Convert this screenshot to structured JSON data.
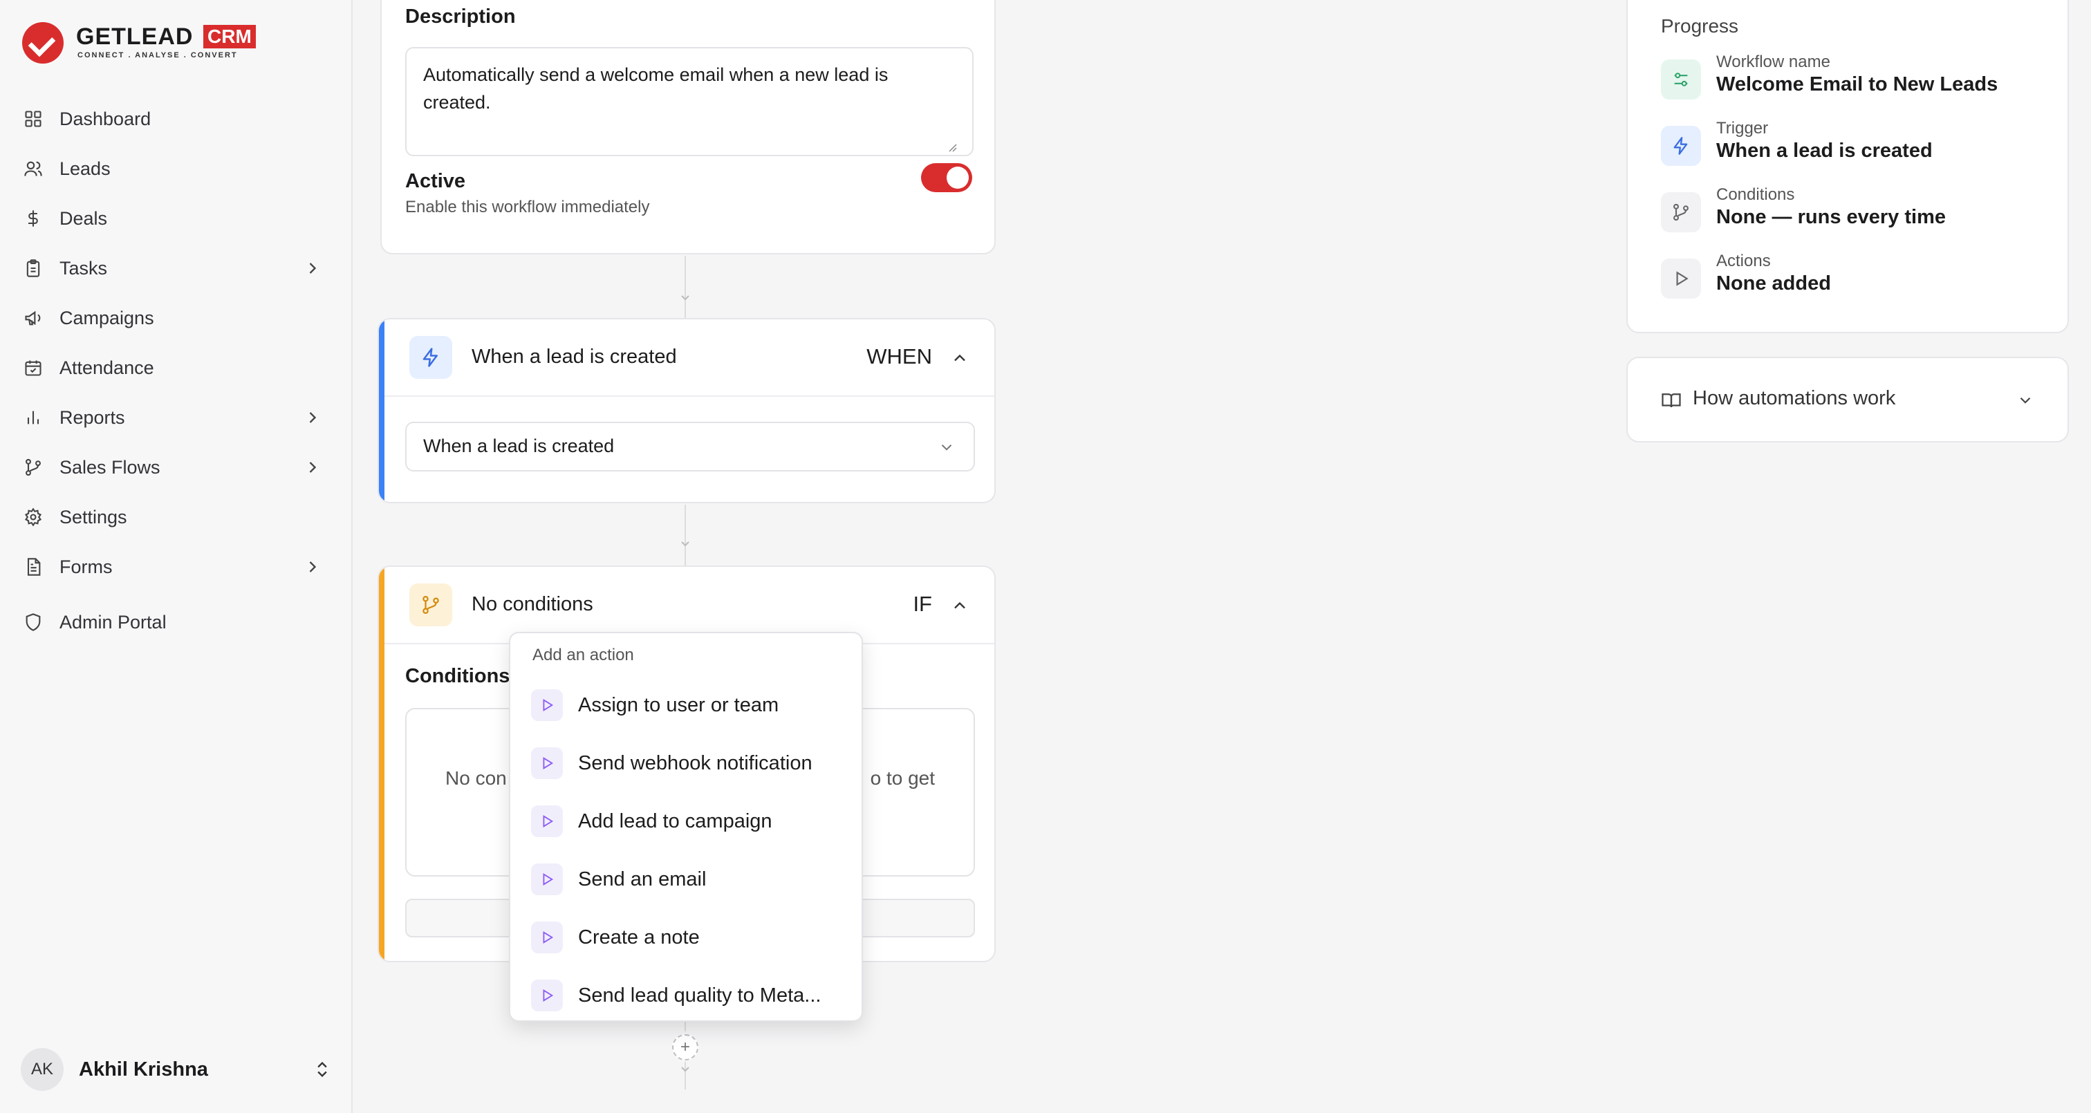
{
  "brand": {
    "name": "GETLEAD",
    "badge": "CRM",
    "tagline": "CONNECT . ANALYSE . CONVERT"
  },
  "sidebar": {
    "items": [
      {
        "label": "Dashboard",
        "icon": "grid-icon",
        "has_submenu": false
      },
      {
        "label": "Leads",
        "icon": "users-icon",
        "has_submenu": false
      },
      {
        "label": "Deals",
        "icon": "dollar-icon",
        "has_submenu": false
      },
      {
        "label": "Tasks",
        "icon": "clipboard-icon",
        "has_submenu": true
      },
      {
        "label": "Campaigns",
        "icon": "megaphone-icon",
        "has_submenu": false
      },
      {
        "label": "Attendance",
        "icon": "calendar-check-icon",
        "has_submenu": false
      },
      {
        "label": "Reports",
        "icon": "bar-chart-icon",
        "has_submenu": true
      },
      {
        "label": "Sales Flows",
        "icon": "git-branch-icon",
        "has_submenu": true
      },
      {
        "label": "Settings",
        "icon": "gear-icon",
        "has_submenu": false
      },
      {
        "label": "Forms",
        "icon": "file-text-icon",
        "has_submenu": true
      },
      {
        "label": "Admin Portal",
        "icon": "shield-icon",
        "has_submenu": false
      }
    ],
    "user": {
      "initials": "AK",
      "name": "Akhil Krishna"
    }
  },
  "description": {
    "label": "Description",
    "value": "Automatically send a welcome email when a new lead is created."
  },
  "active": {
    "label": "Active",
    "sublabel": "Enable this workflow immediately",
    "enabled": true
  },
  "trigger_step": {
    "title": "When a lead is created",
    "kind": "WHEN",
    "select_value": "When a lead is created",
    "accent": "#3b82f6"
  },
  "condition_step": {
    "title": "No conditions",
    "kind": "IF",
    "section_label": "Conditions",
    "empty_left": "No con",
    "empty_right": "o to get",
    "accent": "#f5a623"
  },
  "action_menu": {
    "title": "Add an action",
    "items": [
      "Assign to user or team",
      "Send webhook notification",
      "Add lead to campaign",
      "Send an email",
      "Create a note",
      "Send lead quality to Meta..."
    ]
  },
  "progress": {
    "title": "Progress",
    "rows": [
      {
        "key": "Workflow name",
        "value": "Welcome Email to New Leads",
        "icon": "sliders-icon",
        "color": "#2fa36b",
        "bg": "#e6f6ee"
      },
      {
        "key": "Trigger",
        "value": "When a lead is created",
        "icon": "bolt-icon",
        "color": "#3b6fe0",
        "bg": "#e6efff"
      },
      {
        "key": "Conditions",
        "value": "None — runs every time",
        "icon": "branch-icon",
        "color": "#666",
        "bg": "#f2f2f4"
      },
      {
        "key": "Actions",
        "value": "None added",
        "icon": "play-icon",
        "color": "#666",
        "bg": "#f2f2f4"
      }
    ]
  },
  "help": {
    "label": "How automations work"
  }
}
